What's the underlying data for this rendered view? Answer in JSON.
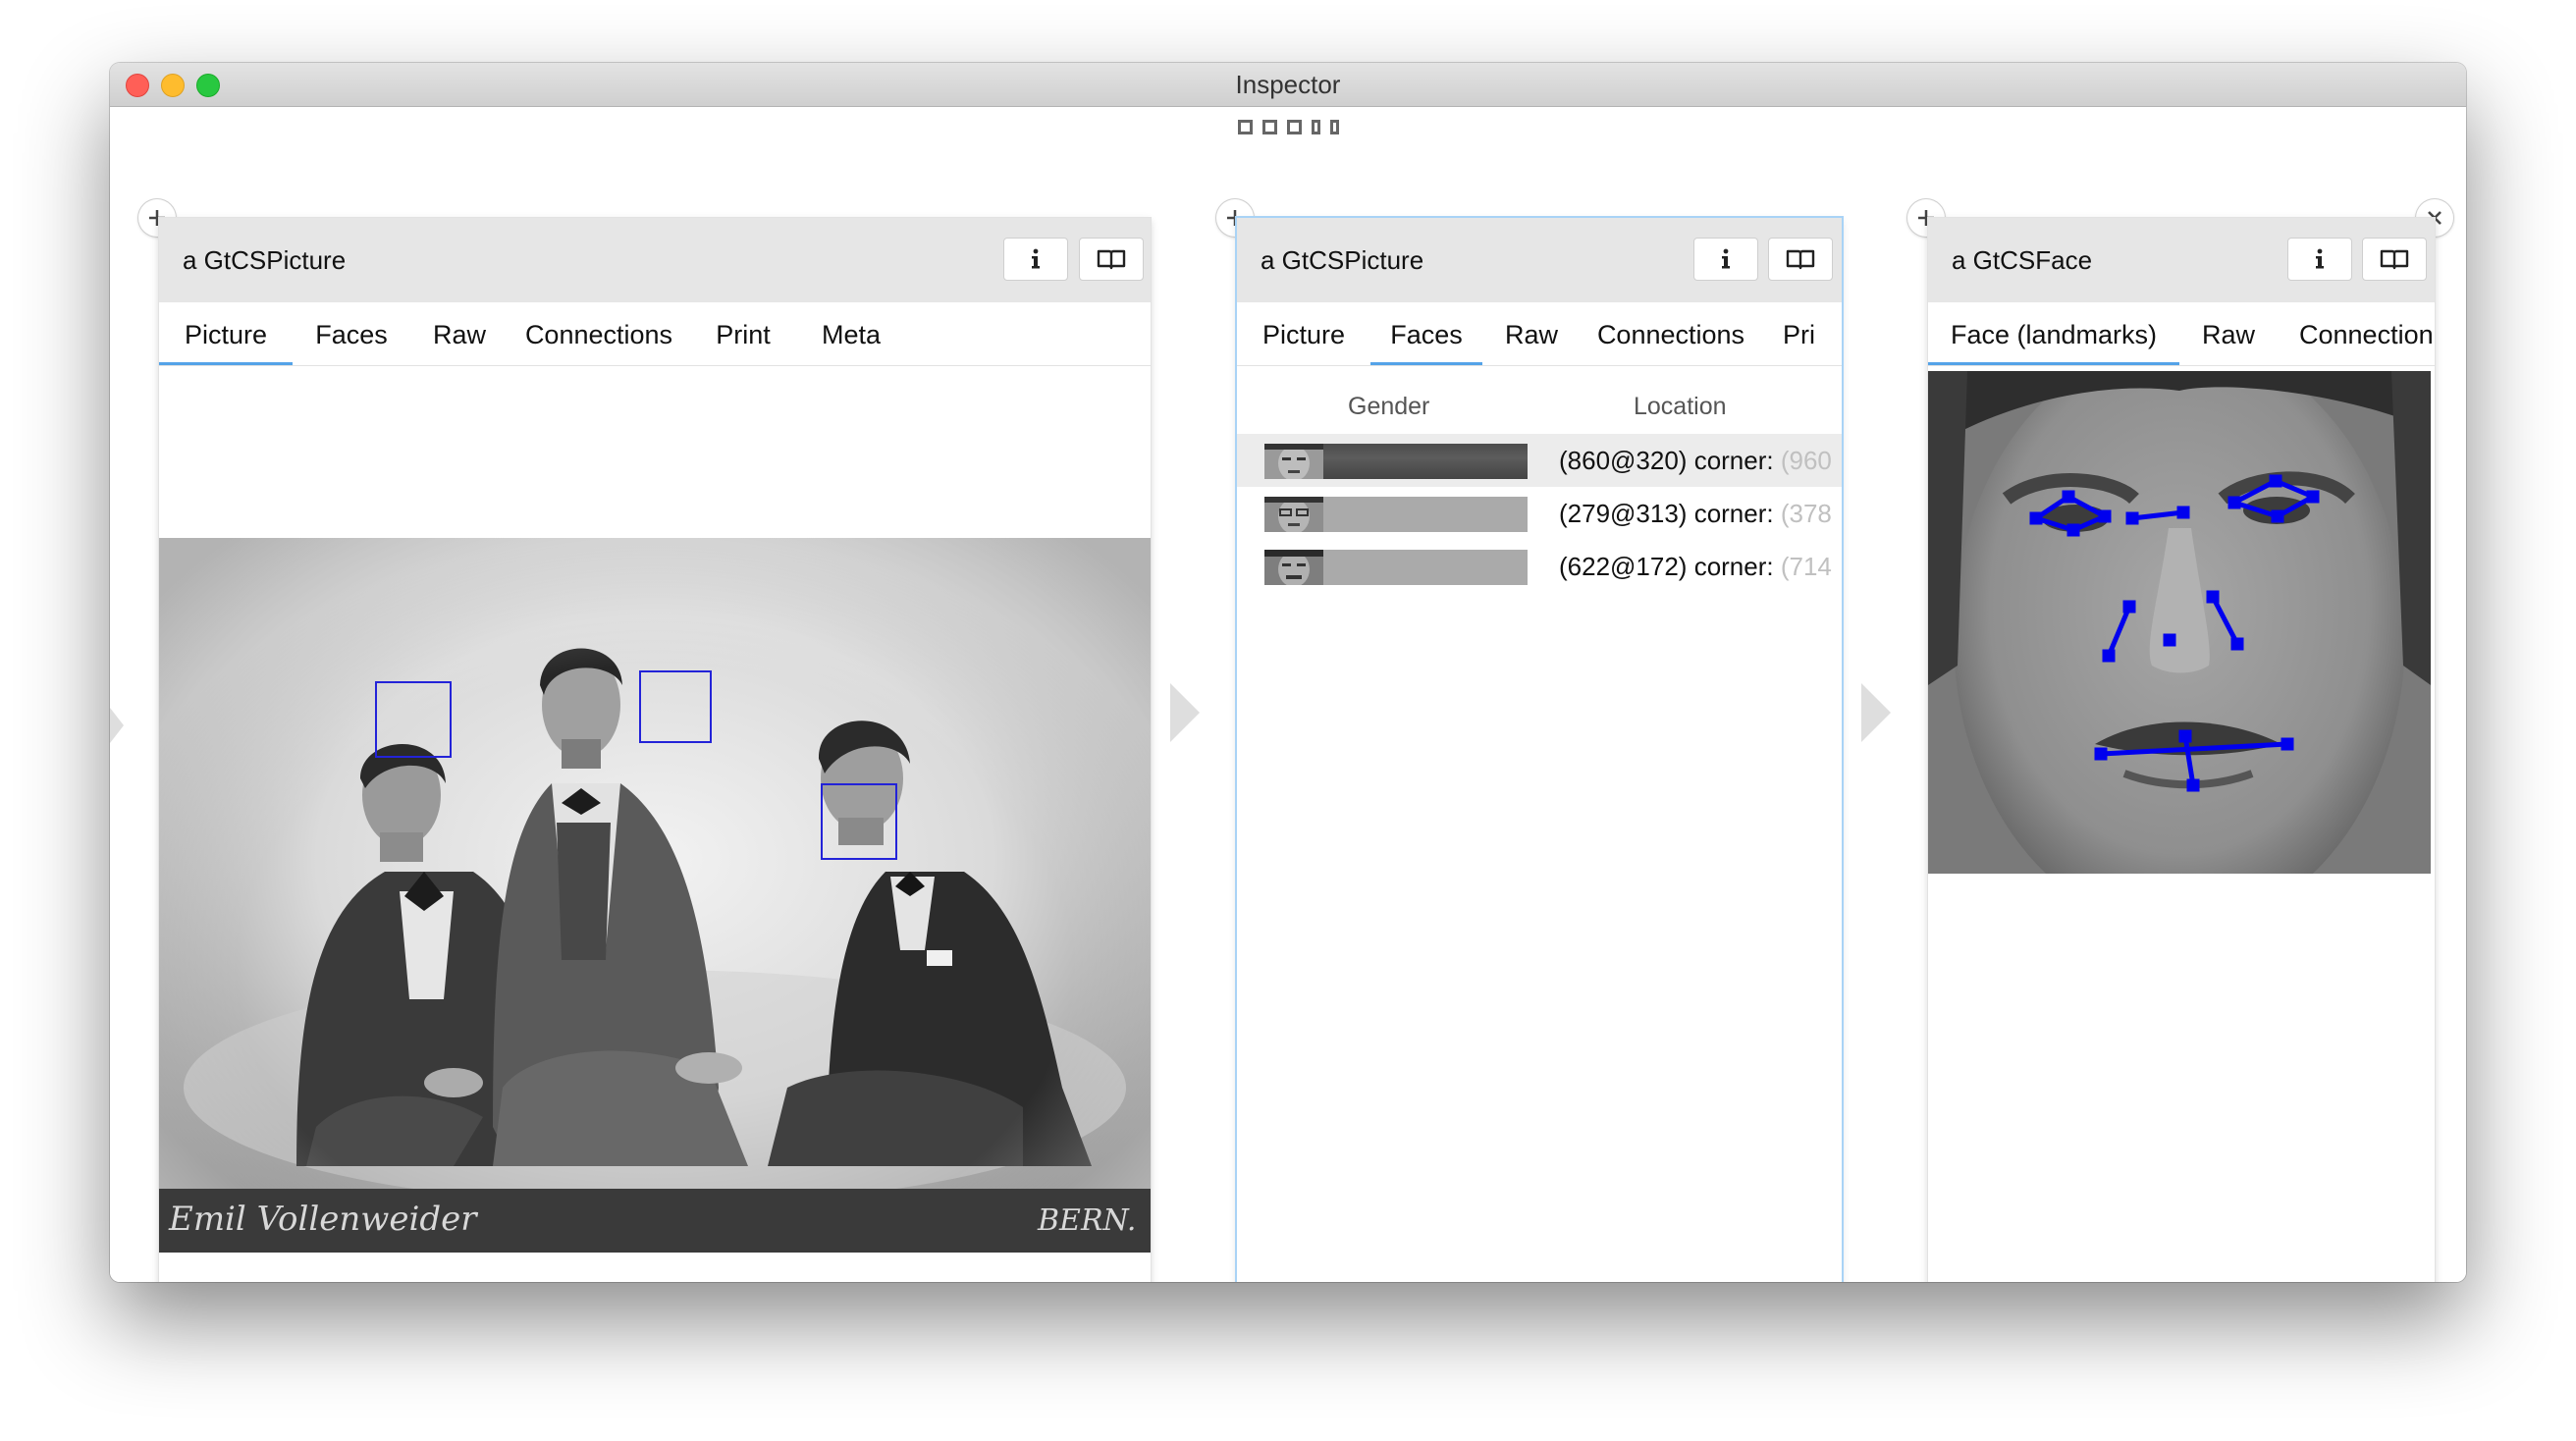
{
  "window": {
    "title": "Inspector"
  },
  "panes": [
    {
      "title": "a GtCSPicture",
      "tabs": [
        "Picture",
        "Faces",
        "Raw",
        "Connections",
        "Print",
        "Meta"
      ],
      "active_tab": "Picture",
      "photo_caption": {
        "left": "Emil Vollenweider",
        "right": "BERN."
      }
    },
    {
      "title": "a GtCSPicture",
      "tabs": [
        "Picture",
        "Faces",
        "Raw",
        "Connections",
        "Pri"
      ],
      "active_tab": "Faces",
      "columns": [
        "Gender",
        "Location"
      ],
      "rows": [
        {
          "location": "(860@320) corner: ",
          "location_fade": "(960",
          "selected": true
        },
        {
          "location": "(279@313) corner: ",
          "location_fade": "(378",
          "selected": false
        },
        {
          "location": "(622@172) corner: ",
          "location_fade": "(714",
          "selected": false
        }
      ]
    },
    {
      "title": "a GtCSFace",
      "tabs": [
        "Face (landmarks)",
        "Raw",
        "Connection"
      ],
      "active_tab": "Face (landmarks)"
    }
  ],
  "colors": {
    "accent": "#54a3e8",
    "landmarks": "#0000ee",
    "face_box": "#2323d8"
  },
  "icons": [
    "plus-icon",
    "info-icon",
    "book-icon",
    "close-icon",
    "chevron-right-icon"
  ]
}
